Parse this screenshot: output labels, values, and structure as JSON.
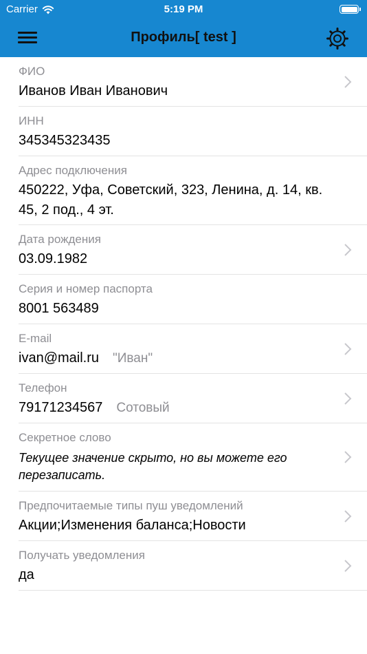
{
  "status_bar": {
    "carrier": "Carrier",
    "time": "5:19 PM"
  },
  "nav": {
    "title": "Профиль[ test ]",
    "accent_color": "#1787d0"
  },
  "fields": [
    {
      "label": "ФИО",
      "value": "Иванов Иван Иванович",
      "extra": "",
      "chevron": true
    },
    {
      "label": "ИНН",
      "value": "345345323435",
      "extra": "",
      "chevron": false
    },
    {
      "label": "Адрес подключения",
      "value": "450222, Уфа, Советский, 323, Ленина, д. 14, кв. 45, 2 под., 4 эт.",
      "extra": "",
      "chevron": false
    },
    {
      "label": "Дата рождения",
      "value": "03.09.1982",
      "extra": "",
      "chevron": true
    },
    {
      "label": "Серия и номер паспорта",
      "value": "8001 563489",
      "extra": "",
      "chevron": false
    },
    {
      "label": "E-mail",
      "value": "ivan@mail.ru",
      "extra": "\"Иван\"",
      "chevron": true
    },
    {
      "label": "Телефон",
      "value": "79171234567",
      "extra": "Сотовый",
      "chevron": true
    },
    {
      "label": "Секретное слово",
      "value": "Текущее значение скрыто, но вы можете его перезаписать.",
      "extra": "",
      "chevron": true
    },
    {
      "label": "Предпочитаемые типы пуш уведомлений",
      "value": "Акции;Изменения баланса;Новости",
      "extra": "",
      "chevron": true
    },
    {
      "label": "Получать уведомления",
      "value": "да",
      "extra": "",
      "chevron": true
    }
  ]
}
